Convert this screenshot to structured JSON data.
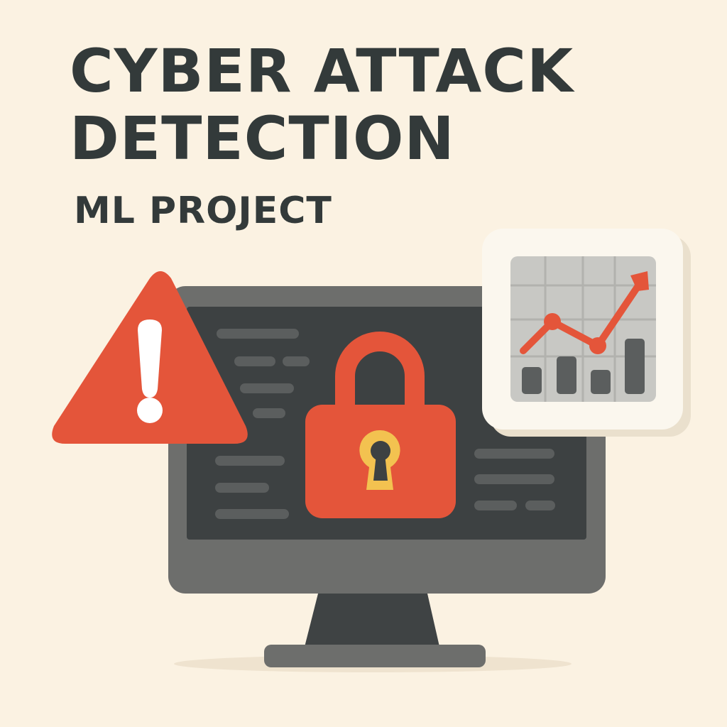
{
  "title": {
    "line1": "CYBER ATTACK",
    "line2": "DETECTION"
  },
  "subtitle": "ML PROJECT",
  "colors": {
    "background": "#fbf2e2",
    "text": "#333a3a",
    "accent_red": "#e4553a",
    "monitor_frame": "#6d6e6c",
    "screen": "#3d4142",
    "keyhole_yellow": "#f3c250",
    "chart_panel": "#c8c8c4"
  },
  "icons": {
    "warning": "warning-triangle-icon",
    "lock": "padlock-icon",
    "chart": "chart-icon",
    "monitor": "monitor-icon"
  }
}
